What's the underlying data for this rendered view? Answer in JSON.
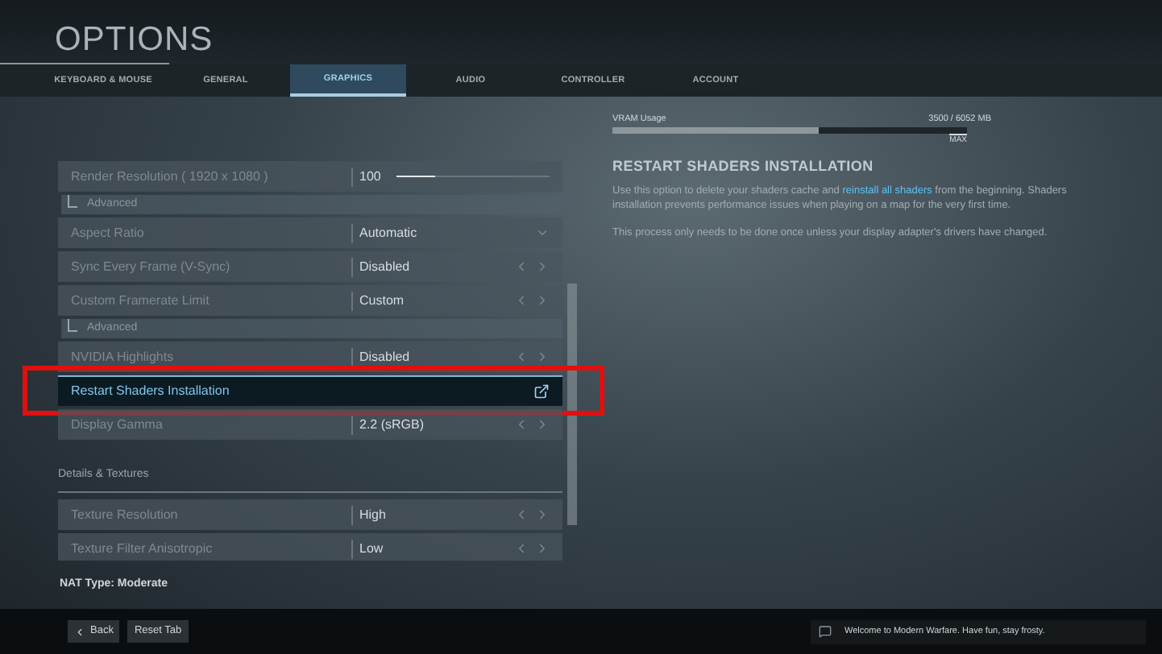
{
  "title": "OPTIONS",
  "tabs": [
    {
      "label": "KEYBOARD & MOUSE",
      "selected": false
    },
    {
      "label": "GENERAL",
      "selected": false
    },
    {
      "label": "GRAPHICS",
      "selected": true
    },
    {
      "label": "AUDIO",
      "selected": false
    },
    {
      "label": "CONTROLLER",
      "selected": false
    },
    {
      "label": "ACCOUNT",
      "selected": false
    }
  ],
  "settings": [
    {
      "kind": "slider",
      "label": "Render Resolution ( 1920 x 1080 )",
      "value": "100",
      "level": 0.25,
      "selected": false
    },
    {
      "kind": "sub",
      "label": "Advanced"
    },
    {
      "kind": "dropdown",
      "label": "Aspect Ratio",
      "value": "Automatic",
      "selected": false
    },
    {
      "kind": "arrows",
      "label": "Sync Every Frame (V-Sync)",
      "value": "Disabled",
      "selected": false
    },
    {
      "kind": "arrows",
      "label": "Custom Framerate Limit",
      "value": "Custom",
      "selected": false
    },
    {
      "kind": "sub",
      "label": "Advanced"
    },
    {
      "kind": "arrows",
      "label": "NVIDIA Highlights",
      "value": "Disabled",
      "selected": false
    },
    {
      "kind": "action",
      "label": "Restart Shaders Installation",
      "selected": true,
      "highlighted": true
    },
    {
      "kind": "arrows",
      "label": "Display Gamma",
      "value": "2.2 (sRGB)",
      "selected": false
    },
    {
      "kind": "section",
      "label": "Details & Textures"
    },
    {
      "kind": "arrows",
      "label": "Texture Resolution",
      "value": "High",
      "selected": false
    },
    {
      "kind": "arrows",
      "label": "Texture Filter Anisotropic",
      "value": "Low",
      "selected": false
    }
  ],
  "nat_type": "NAT Type: Moderate",
  "vram": {
    "label": "VRAM Usage",
    "reading": "3500 / 6052 MB",
    "level": 0.58,
    "max_label": "MAX"
  },
  "detail": {
    "title": "RESTART SHADERS INSTALLATION",
    "paragraphs": [
      "Use this option to delete your shaders cache and **reinstall all shaders** from the beginning. Shaders installation prevents performance issues when playing on a map for the very first time.",
      "This process only needs to be done once unless your display adapter's drivers have changed."
    ]
  },
  "footer": {
    "buttons": [
      "Back",
      "Reset Tab"
    ],
    "message": "Welcome to Modern Warfare. Have fun, stay frosty."
  }
}
